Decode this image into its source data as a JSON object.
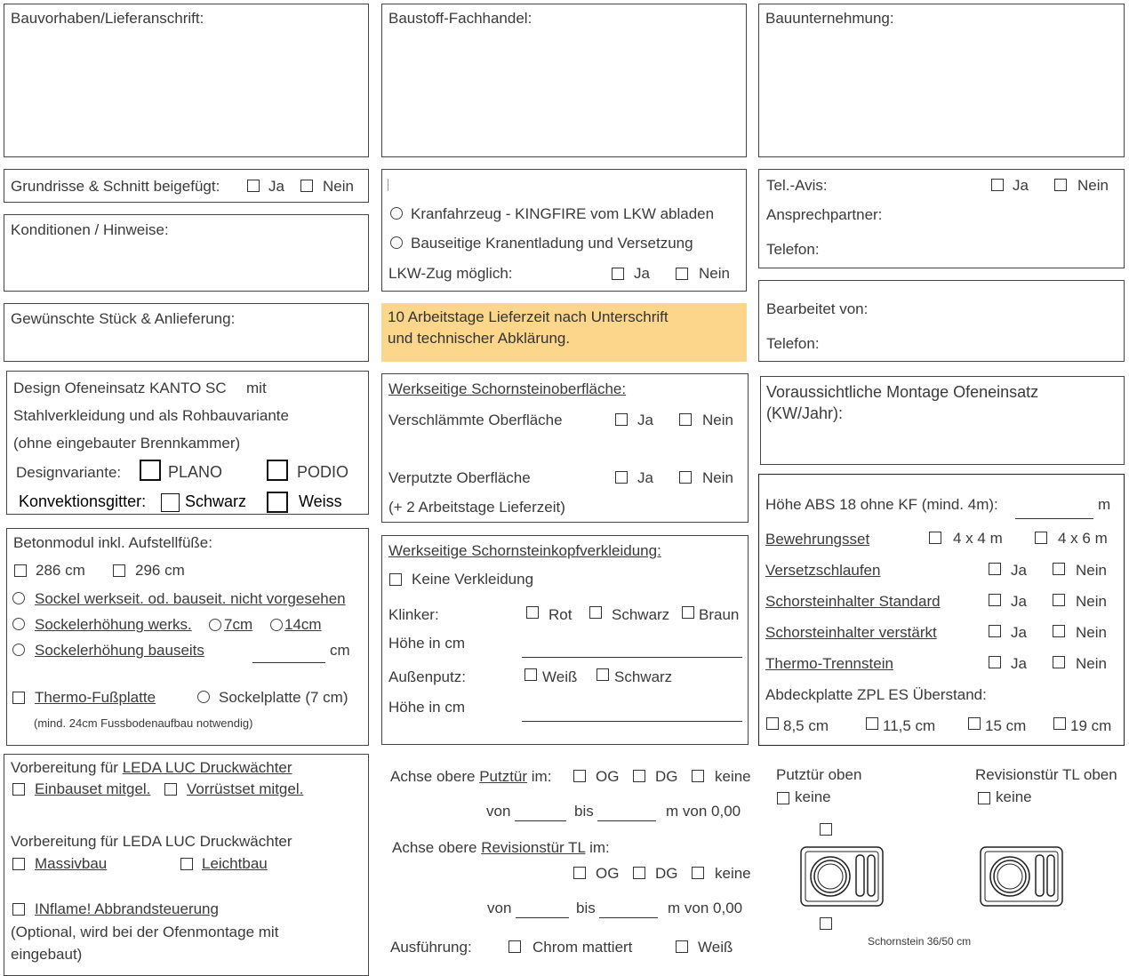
{
  "top": {
    "bauvorhaben": "Bauvorhaben/Lieferanschrift:",
    "baustoff": "Baustoff-Fachhandel:",
    "bauunternehmung": "Bauunternehmung:"
  },
  "grundrisse": {
    "label": "Grundrisse & Schnitt beigefügt:",
    "ja": "Ja",
    "nein": "Nein"
  },
  "konditionen": {
    "label": "Konditionen / Hinweise:"
  },
  "kran": {
    "option1": "Kranfahrzeug - KINGFIRE vom LKW abladen",
    "option2": "Bauseitige Kranentladung und Versetzung",
    "lkw_label": "LKW-Zug möglich:",
    "ja": "Ja",
    "nein": "Nein"
  },
  "tel_avis": {
    "label": "Tel.-Avis:",
    "ja": "Ja",
    "nein": "Nein",
    "ansprech": "Ansprechpartner:",
    "telefon": "Telefon:"
  },
  "gewuenschte": {
    "label": "Gewünschte Stück & Anlieferung:"
  },
  "lieferzeit": {
    "line1": "10 Arbeitstage Lieferzeit nach Unterschrift",
    "line2": "und technischer Abklärung."
  },
  "bearbeitet": {
    "label": "Bearbeitet von:",
    "telefon": "Telefon:"
  },
  "design": {
    "line1": "Design Ofeneinsatz KANTO SC",
    "line1b": "mit",
    "line2": "Stahlverkleidung und als Rohbauvariante",
    "line3": "(ohne eingebauter Brennkammer)",
    "variante_label": "Designvariante:",
    "plano": "PLANO",
    "podio": "PODIO",
    "konvektion_label": "Konvektionsgitter:",
    "schwarz": "Schwarz",
    "weiss": "Weiss"
  },
  "oberflaeche": {
    "title": "Werkseitige Schornsteinoberfläche:",
    "verschlaemmt": "Verschlämmte Oberfläche",
    "verputzt": "Verputzte Oberfläche",
    "hinweis": "(+ 2 Arbeitstage Lieferzeit)",
    "ja": "Ja",
    "nein": "Nein"
  },
  "montage": {
    "line1": "Voraussichtliche Montage Ofeneinsatz",
    "line2": "(KW/Jahr):"
  },
  "betonmodul": {
    "title": "Betonmodul inkl. Aufstellfüße:",
    "opt286": "286 cm",
    "opt296": "296 cm",
    "sockel_none": "Sockel werkseit. od. bauseit. nicht vorgesehen",
    "sockel_werks": "Sockelerhöhung werks.",
    "opt7": "7cm",
    "opt14": "14cm",
    "sockel_bauseits": "Sockelerhöhung bauseits",
    "cm": "cm",
    "thermo": "Thermo-Fußplatte",
    "sockelplatte": "Sockelplatte (7 cm)",
    "hinweis": "(mind. 24cm Fussbodenaufbau notwendig)"
  },
  "kopfverkleidung": {
    "title": "Werkseitige Schornsteinkopfverkleidung:",
    "keine": "Keine Verkleidung",
    "klinker": "Klinker:",
    "rot": "Rot",
    "schwarz": "Schwarz",
    "braun": "Braun",
    "hoehe": "Höhe in cm",
    "aussenputz": "Außenputz:",
    "weiss": "Weiß",
    "schwarz2": "Schwarz",
    "hoehe2": "Höhe in cm"
  },
  "hoehe": {
    "label": "Höhe ABS 18 ohne KF (mind. 4m):",
    "m": "m",
    "bewehrung": "Bewehrungsset",
    "bew_opt1": "4 x 4 m",
    "bew_opt2": "4 x 6 m",
    "rows": [
      {
        "label": "Versetzschlaufen",
        "ja": "Ja",
        "nein": "Nein"
      },
      {
        "label": "Schorsteinhalter Standard",
        "ja": "Ja",
        "nein": "Nein"
      },
      {
        "label": "Schorsteinhalter verstärkt",
        "ja": "Ja",
        "nein": "Nein"
      },
      {
        "label": "Thermo-Trennstein",
        "ja": "Ja",
        "nein": "Nein"
      }
    ],
    "abdeck": "Abdeckplatte ZPL ES Überstand:",
    "sizes": [
      "8,5 cm",
      "11,5 cm",
      "15 cm",
      "19 cm"
    ]
  },
  "leda": {
    "title1_pre": "Vorbereitung für ",
    "title1_link": "LEDA LUC Druckwächter",
    "einbauset": "Einbauset mitgel.",
    "vorruestset": "Vorrüstset mitgel.",
    "title2": "Vorbereitung für LEDA LUC Druckwächter",
    "massivbau": "Massivbau",
    "leichtbau": "Leichtbau",
    "inflame": "INflame! Abbrandsteuerung",
    "hinweis1": "(Optional, wird bei der Ofenmontage mit",
    "hinweis2": "eingebaut)"
  },
  "achse": {
    "putztuer_pre": "Achse obere ",
    "putztuer_link": "Putztür",
    "putztuer_post": " im:",
    "og": "OG",
    "dg": "DG",
    "keine": "keine",
    "von": "von",
    "bis": "bis",
    "m_von": "m von 0,00",
    "revision_pre": "Achse obere ",
    "revision_link": "Revisionstür TL",
    "revision_post": " im:",
    "ausfuehrung": "Ausführung:",
    "chrom": "Chrom mattiert",
    "weiss": "Weiß"
  },
  "schornstein": {
    "putztuer_oben": "Putztür oben",
    "revision_oben": "Revisionstür TL oben",
    "keine": "keine",
    "caption": "Schornstein 36/50 cm"
  },
  "colors": {
    "highlight": "#fcd68a",
    "border": "#444444"
  }
}
